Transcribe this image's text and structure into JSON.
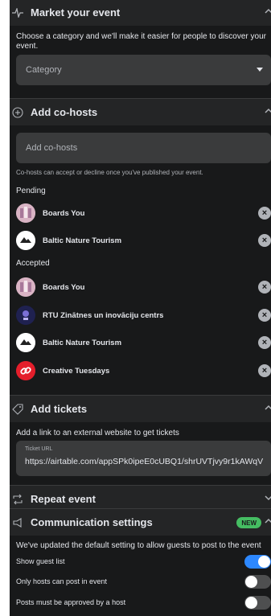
{
  "market": {
    "title": "Market your event",
    "description": "Choose a category and we'll make it easier for people to discover your event.",
    "category_placeholder": "Category"
  },
  "cohosts": {
    "title": "Add co-hosts",
    "input_placeholder": "Add co-hosts",
    "hint": "Co-hosts can accept or decline once you've published your event.",
    "pending_label": "Pending",
    "pending": [
      {
        "name": "Boards You",
        "avatar": "boards-you-avatar"
      },
      {
        "name": "Baltic Nature Tourism",
        "avatar": "baltic-nature-avatar"
      }
    ],
    "accepted_label": "Accepted",
    "accepted": [
      {
        "name": "Boards You",
        "avatar": "boards-you-avatar"
      },
      {
        "name": "RTU Zinātnes un inovāciju centrs",
        "avatar": "rtu-avatar"
      },
      {
        "name": "Baltic Nature Tourism",
        "avatar": "baltic-nature-avatar"
      },
      {
        "name": "Creative Tuesdays",
        "avatar": "creative-tuesdays-avatar"
      }
    ]
  },
  "tickets": {
    "title": "Add tickets",
    "description": "Add a link to an external website to get tickets",
    "url_label": "Ticket URL",
    "url_value": "https://airtable.com/appSPk0ipeE0cUBQ1/shrUVTjvy9r1kAWqV"
  },
  "repeat": {
    "title": "Repeat event"
  },
  "communication": {
    "title": "Communication settings",
    "badge": "NEW",
    "description": "We've updated the default setting to allow guests to post to the event",
    "settings": [
      {
        "label": "Show guest list",
        "on": true
      },
      {
        "label": "Only hosts can post in event",
        "on": false
      },
      {
        "label": "Posts must be approved by a host",
        "on": false
      }
    ]
  },
  "colors": {
    "panel_bg": "#18191a",
    "field_bg": "#3a3b3c",
    "accent": "#2d88ff",
    "badge_green": "#45bd62"
  }
}
